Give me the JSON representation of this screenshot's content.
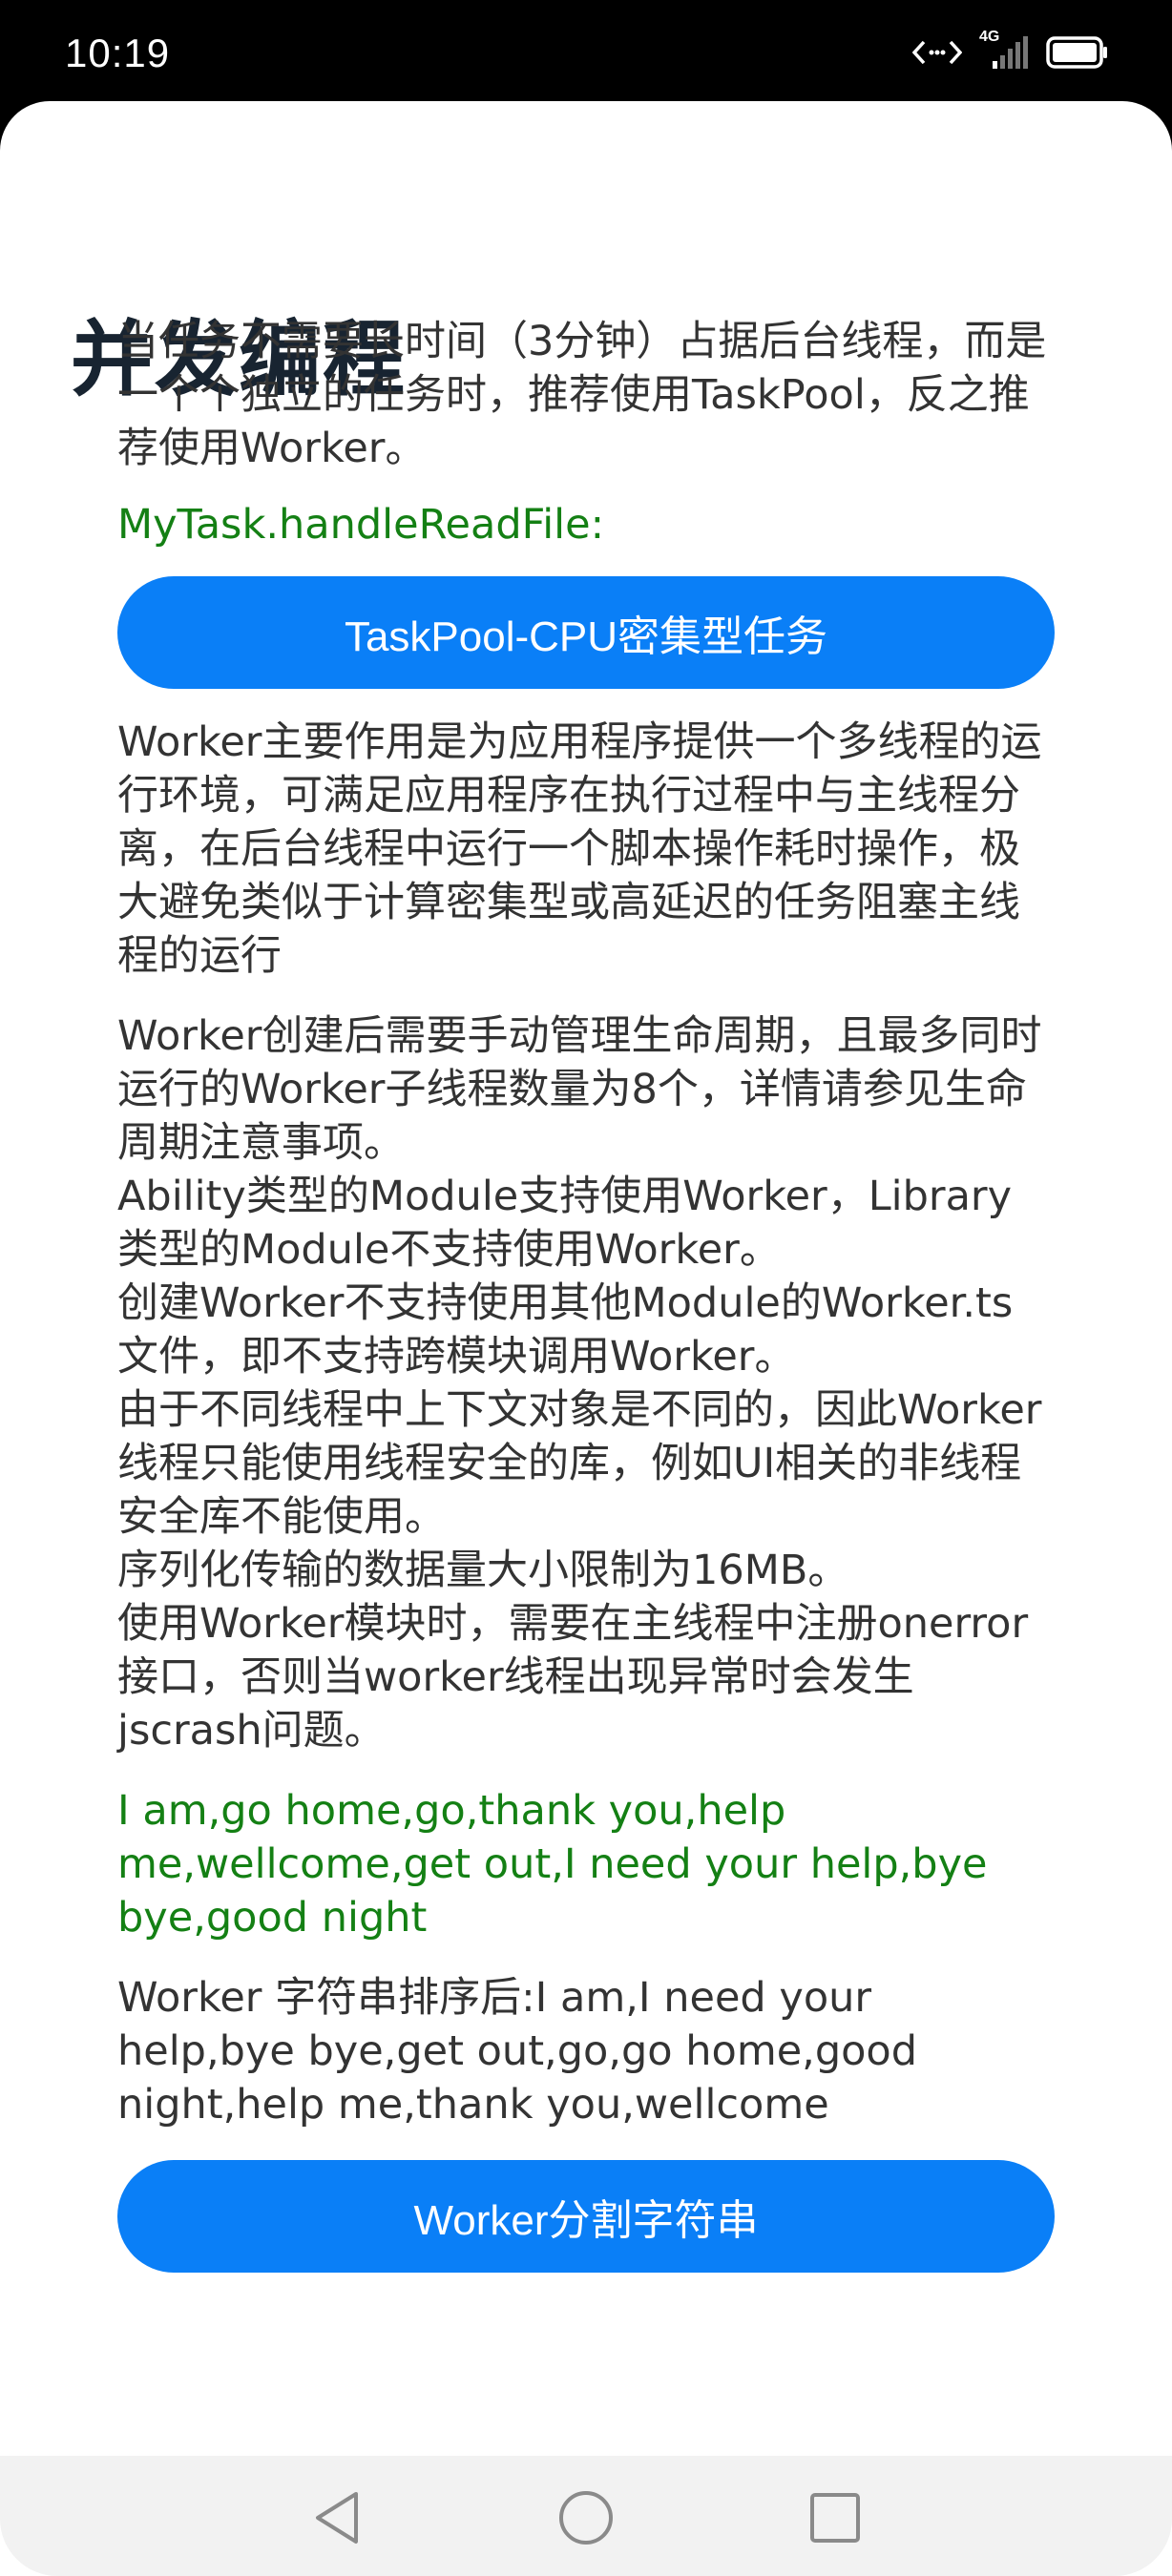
{
  "status": {
    "time": "10:19",
    "network_label": "4G",
    "icons": [
      "data-transfer-icon",
      "signal-icon",
      "battery-icon"
    ]
  },
  "page": {
    "title": "并发编程",
    "intro": "当任务不需要长时间（3分钟）占据后台线程，而是一个个独立的任务时，推荐使用TaskPool，反之推荐使用Worker。",
    "taskpool_result": "MyTask.handleReadFile:",
    "taskpool_button": "TaskPool-CPU密集型任务",
    "worker_desc": "Worker主要作用是为应用程序提供一个多线程的运行环境，可满足应用程序在执行过程中与主线程分离，在后台线程中运行一个脚本操作耗时操作，极大避免类似于计算密集型或高延迟的任务阻塞主线程的运行",
    "worker_notes": [
      "Worker创建后需要手动管理生命周期，且最多同时运行的Worker子线程数量为8个，详情请参见生命周期注意事项。",
      "Ability类型的Module支持使用Worker，Library类型的Module不支持使用Worker。",
      "创建Worker不支持使用其他Module的Worker.ts文件，即不支持跨模块调用Worker。",
      "由于不同线程中上下文对象是不同的，因此Worker线程只能使用线程安全的库，例如UI相关的非线程安全库不能使用。",
      "序列化传输的数据量大小限制为16MB。",
      "使用Worker模块时，需要在主线程中注册onerror接口，否则当worker线程出现异常时会发生jscrash问题。"
    ],
    "input_strings": "I am,go home,go,thank you,help me,wellcome,get out,I need your help,bye bye,good night",
    "sorted_result": "Worker 字符串排序后:I am,I need your help,bye bye,get out,go,go home,good night,help me,thank you,wellcome",
    "worker_button": "Worker分割字符串"
  },
  "nav": {
    "icons": [
      "back-icon",
      "home-icon",
      "recents-icon"
    ]
  },
  "colors": {
    "accent": "#0a7ff7",
    "result_green": "#148014",
    "title": "#182431",
    "body_text": "#333333"
  }
}
